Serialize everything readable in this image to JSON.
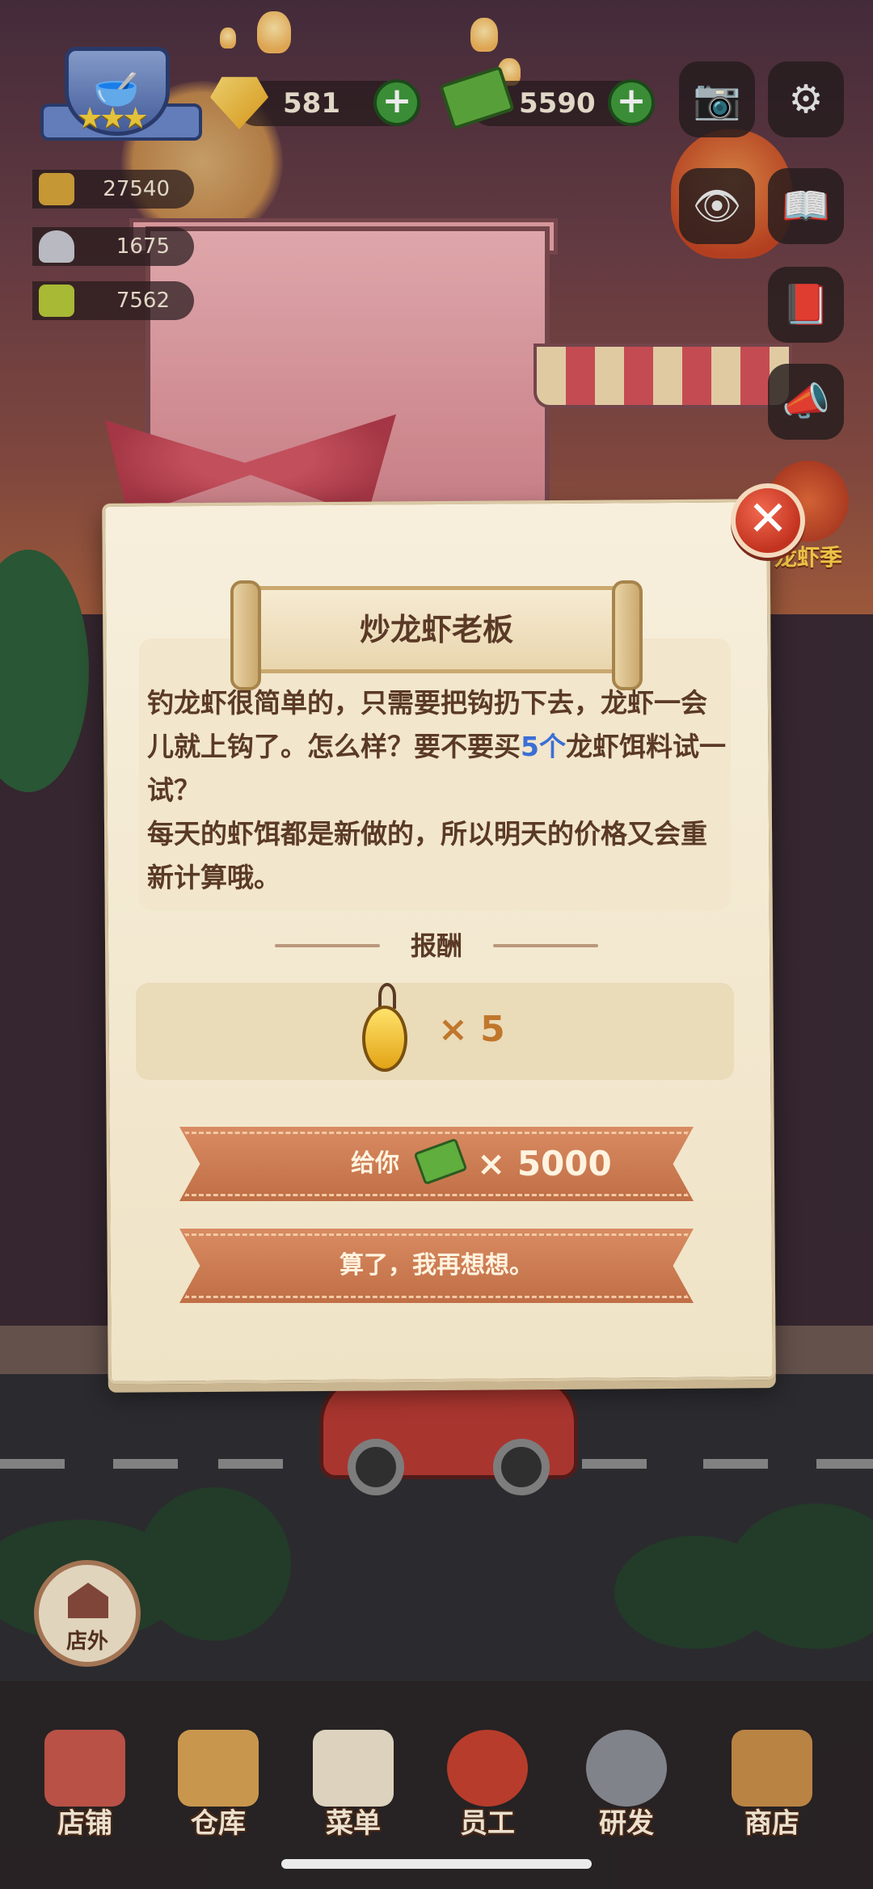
{
  "hud": {
    "gems": "581",
    "cash": "5590",
    "stats": [
      {
        "icon": "coins-stack-icon",
        "value": "27540"
      },
      {
        "icon": "food-dish-icon",
        "value": "1675"
      },
      {
        "icon": "ticket-icon",
        "value": "7562"
      }
    ],
    "event_label": "龙虾季"
  },
  "dialog": {
    "title": "炒龙虾老板",
    "description": {
      "part1": "钓龙虾很简单的，只需要把钩扔下去，龙虾一会儿就上钩了。怎么样？要不要买",
      "highlight": "5个",
      "part2": "龙虾饵料试一试？",
      "part3": "每天的虾饵都是新做的，所以明天的价格又会重新计算哦。"
    },
    "reward_title": "报酬",
    "reward_item_icon": "shrimp-bait-icon",
    "reward_count": "× 5",
    "buy_label": "给你",
    "buy_amount": "× 5000",
    "decline_label": "算了，我再想想。"
  },
  "outside_button": "店外",
  "nav": [
    {
      "label": "店铺",
      "icon": "shop-building-icon"
    },
    {
      "label": "仓库",
      "icon": "warehouse-boxes-icon"
    },
    {
      "label": "菜单",
      "icon": "menu-clipboard-icon"
    },
    {
      "label": "员工",
      "icon": "staff-chef-icon"
    },
    {
      "label": "研发",
      "icon": "cooking-pot-icon"
    },
    {
      "label": "商店",
      "icon": "store-front-icon"
    }
  ],
  "colors": {
    "highlight_blue": "#3b6fd6",
    "ribbon_orange": "#c06e45",
    "close_red": "#c2331f",
    "plus_green": "#3f9a3b"
  }
}
